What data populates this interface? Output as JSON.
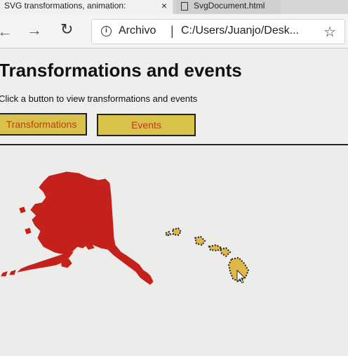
{
  "browser": {
    "tabs": [
      {
        "label": "SVG transformations, animation:",
        "close": "×"
      },
      {
        "label": "SvgDocument.html"
      }
    ],
    "address": {
      "security_label": "Archivo",
      "separator": "|",
      "url": "C:/Users/Juanjo/Desk..."
    },
    "icons": {
      "back": "←",
      "forward": "→",
      "refresh": "↻",
      "info": "i",
      "favorite": "☆"
    }
  },
  "page": {
    "title": "Transformations and events",
    "subtitle": "Click a button to view transformations and events",
    "buttons": {
      "transformations": "Transformations",
      "events": "Events"
    }
  },
  "map": {
    "alaska_color": "#c4201c",
    "hawaii_fill": "#e0b84a",
    "hawaii_stroke": "#222222"
  }
}
